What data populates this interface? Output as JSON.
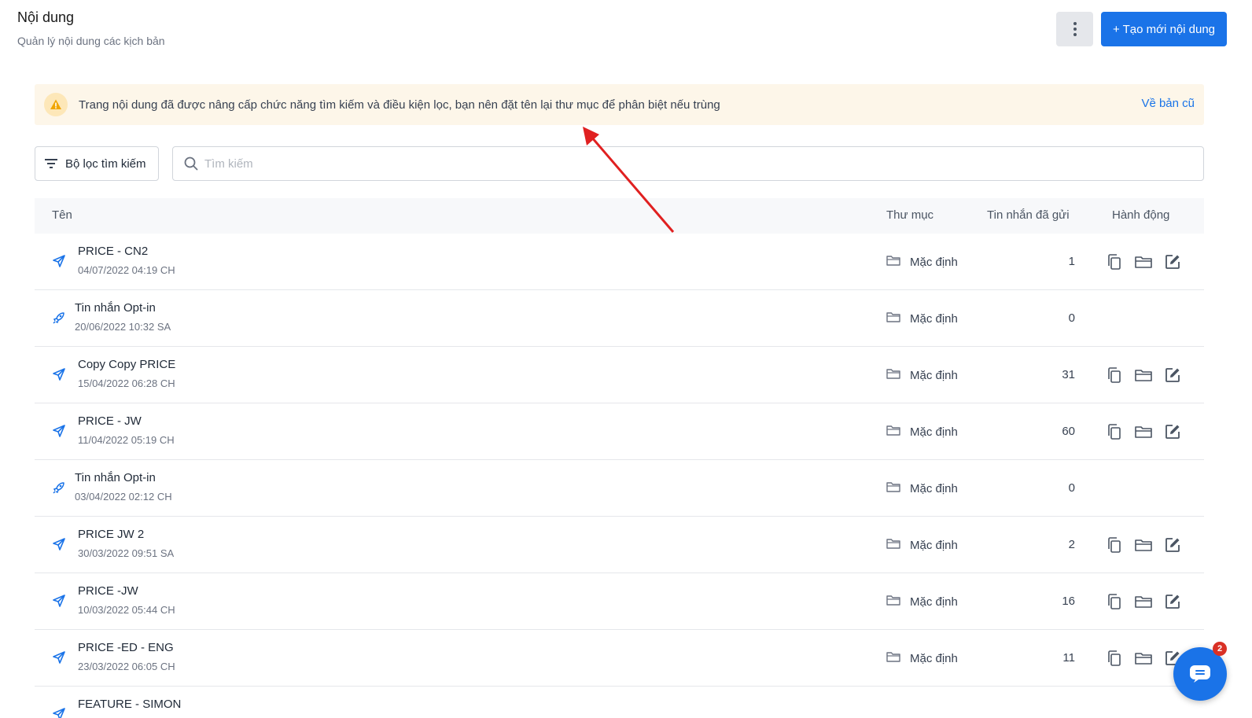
{
  "header": {
    "title": "Nội dung",
    "subtitle": "Quản lý nội dung các kịch bản",
    "create_label": "+ Tạo mới nội dung"
  },
  "notice": {
    "text": "Trang nội dung đã được nâng cấp chức năng tìm kiếm và điều kiện lọc, bạn nên đặt tên lại thư mục để phân biệt nếu trùng",
    "link_label": "Về bản cũ"
  },
  "toolbar": {
    "filter_label": "Bộ lọc tìm kiếm",
    "search_placeholder": "Tìm kiếm"
  },
  "table": {
    "columns": {
      "name": "Tên",
      "folder": "Thư mục",
      "sent": "Tin nhắn đã gửi",
      "actions": "Hành động"
    },
    "rows": [
      {
        "name": "PRICE - CN2",
        "date": "04/07/2022 04:19 CH",
        "folder": "Mặc định",
        "sent": "1",
        "type": "send-icon",
        "has_actions": true
      },
      {
        "name": "Tin nhắn Opt-in",
        "date": "20/06/2022 10:32 SA",
        "folder": "Mặc định",
        "sent": "0",
        "type": "rocket-icon",
        "has_actions": false
      },
      {
        "name": "Copy Copy PRICE",
        "date": "15/04/2022 06:28 CH",
        "folder": "Mặc định",
        "sent": "31",
        "type": "send-icon",
        "has_actions": true
      },
      {
        "name": "PRICE - JW",
        "date": "11/04/2022 05:19 CH",
        "folder": "Mặc định",
        "sent": "60",
        "type": "send-icon",
        "has_actions": true
      },
      {
        "name": "Tin nhắn Opt-in",
        "date": "03/04/2022 02:12 CH",
        "folder": "Mặc định",
        "sent": "0",
        "type": "rocket-icon",
        "has_actions": false
      },
      {
        "name": "PRICE JW 2",
        "date": "30/03/2022 09:51 SA",
        "folder": "Mặc định",
        "sent": "2",
        "type": "send-icon",
        "has_actions": true
      },
      {
        "name": "PRICE -JW",
        "date": "10/03/2022 05:44 CH",
        "folder": "Mặc định",
        "sent": "16",
        "type": "send-icon",
        "has_actions": true
      },
      {
        "name": "PRICE -ED - ENG",
        "date": "23/03/2022 06:05 CH",
        "folder": "Mặc định",
        "sent": "11",
        "type": "send-icon",
        "has_actions": true
      },
      {
        "name": "FEATURE - SIMON",
        "date": "",
        "folder": "",
        "sent": "",
        "type": "send-icon",
        "has_actions": false
      }
    ]
  },
  "chat": {
    "badge": "2"
  },
  "colors": {
    "primary": "#1a73e8",
    "notice_bg": "#fdf6e9",
    "annotation_arrow": "#e02020"
  }
}
